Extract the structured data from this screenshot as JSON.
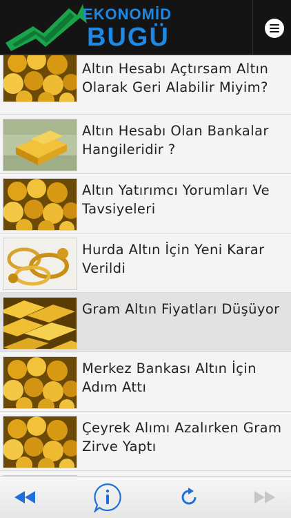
{
  "app": {
    "logo_line1": "EKONOMİDE",
    "logo_line2": "BUGÜN",
    "brand_blue": "#1e88e5",
    "brand_green": "#1aa34a"
  },
  "articles": [
    {
      "title": "Altın Hesabı Açtırsam Altın Olarak Geri Alabilir Miyim?",
      "thumb": "gold-coins"
    },
    {
      "title": "Altın Hesabı Olan Bankalar Hangileridir ?",
      "thumb": "gold-bar-dollars"
    },
    {
      "title": "Altın Yatırımcı Yorumları Ve Tavsiyeleri",
      "thumb": "gold-coins"
    },
    {
      "title": "Hurda Altın İçin Yeni Karar Verildi",
      "thumb": "gold-jewelry"
    },
    {
      "title": "Gram Altın Fiyatları Düşüyor",
      "thumb": "gold-bars"
    },
    {
      "title": "Merkez Bankası Altın İçin Adım Attı",
      "thumb": "gold-coins"
    },
    {
      "title": "Çeyrek Alımı Azalırken Gram Zirve Yaptı",
      "thumb": "gold-coins"
    }
  ],
  "toolbar": {
    "back_icon": "rewind-icon",
    "info_icon": "info-icon",
    "refresh_icon": "refresh-icon",
    "forward_icon": "fast-forward-icon"
  }
}
